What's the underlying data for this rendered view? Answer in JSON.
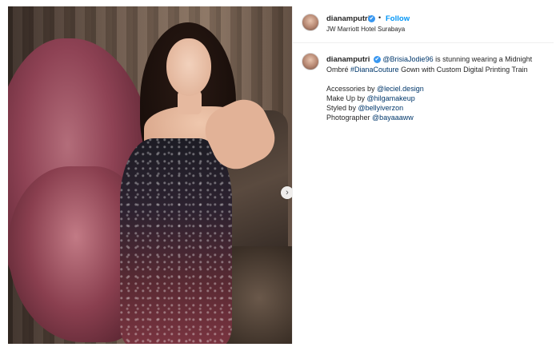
{
  "post": {
    "username": "dianamputri",
    "verified_mark": "✔",
    "separator": "•",
    "follow_label": "Follow",
    "location": "JW Marriott Hotel Surabaya",
    "next_arrow": "›"
  },
  "caption": {
    "username": "dianamputri",
    "mention_1": "@BrisiaJodie96",
    "text_1": " is stunning wearing a Midnight Ombré ",
    "hashtag_1": "#DianaCouture",
    "text_2": " Gown with Custom Digital Printing Train",
    "credits": [
      {
        "label": "Accessories by ",
        "handle": "@leciel.design"
      },
      {
        "label": "Make Up by ",
        "handle": "@hilgamakeup"
      },
      {
        "label": "Styled by ",
        "handle": "@bellyiverzon"
      },
      {
        "label": "Photographer ",
        "handle": "@bayaaaww"
      }
    ]
  },
  "icons": {
    "verified": "verified-badge-icon",
    "next": "chevron-right-icon"
  },
  "colors": {
    "link": "#00376b",
    "follow": "#0095f6",
    "verified": "#3897f0"
  }
}
